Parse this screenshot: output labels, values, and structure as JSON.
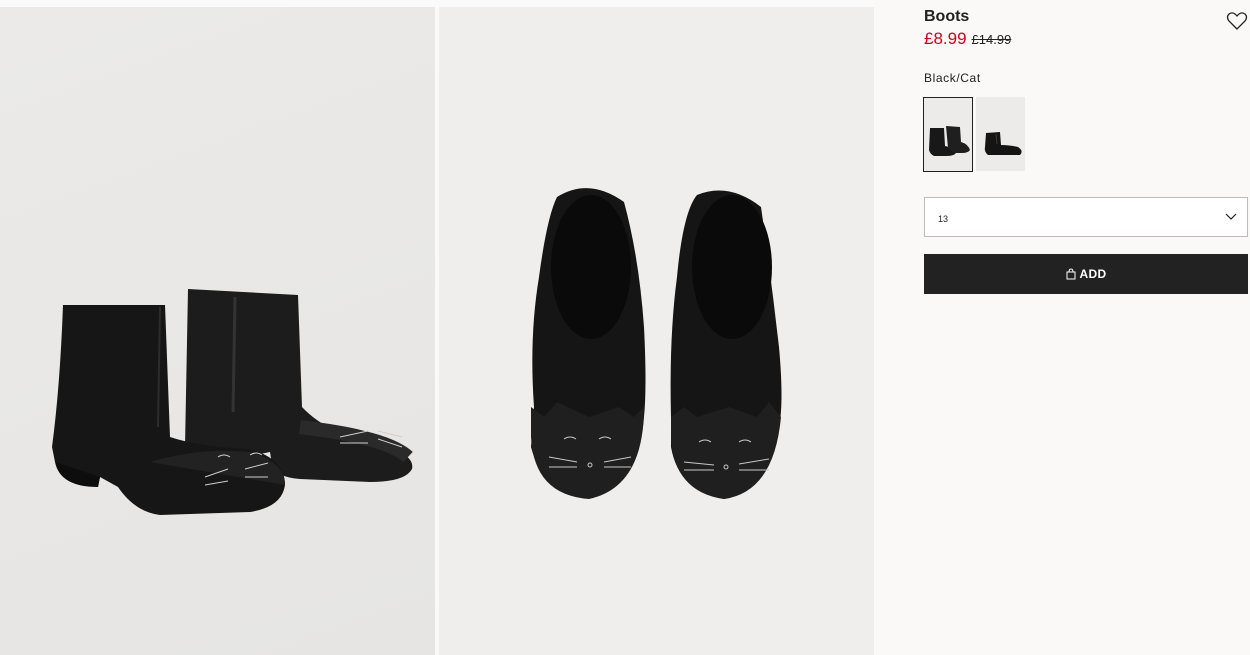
{
  "product": {
    "title": "Boots",
    "price_sale": "£8.99",
    "price_original": "£14.99",
    "color_label": "Black/Cat",
    "size_selected": "13",
    "add_label": "ADD"
  },
  "gallery": {
    "images": [
      {
        "icon": "product-image-boots-side"
      },
      {
        "icon": "product-image-boots-top"
      }
    ]
  },
  "swatches": [
    {
      "name": "Black/Cat",
      "active": true
    },
    {
      "name": "Black",
      "active": false
    }
  ],
  "colors": {
    "sale": "#d0021b",
    "button_bg": "#222222",
    "button_text": "#ffffff"
  },
  "icons": {
    "favorite": "heart-icon",
    "dropdown": "chevron-down-icon",
    "bag": "shopping-bag-icon"
  }
}
